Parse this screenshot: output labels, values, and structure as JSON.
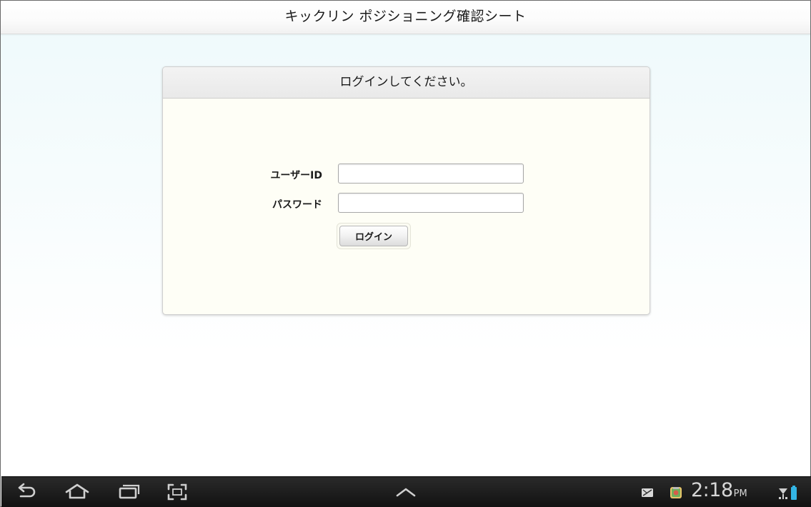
{
  "app": {
    "title": "キックリン ポジショニング確認シート"
  },
  "login_panel": {
    "heading": "ログインしてください。",
    "user_id_label": "ユーザーID",
    "user_id_value": "",
    "password_label": "パスワード",
    "password_value": "",
    "login_button_label": "ログイン"
  },
  "system_bar": {
    "icons": [
      "back-icon",
      "home-icon",
      "recent-apps-icon",
      "screenshot-icon",
      "chevron-up-icon"
    ],
    "notification_icons": [
      "notification-mail-icon",
      "notification-app-icon"
    ],
    "clock_time": "2:18",
    "clock_ampm": "PM",
    "status_icons": [
      "signal-icon",
      "battery-icon"
    ],
    "colors": {
      "bar_bg": "#1a1a1a",
      "icon": "#cfcfcf",
      "battery": "#33b5e5"
    }
  }
}
